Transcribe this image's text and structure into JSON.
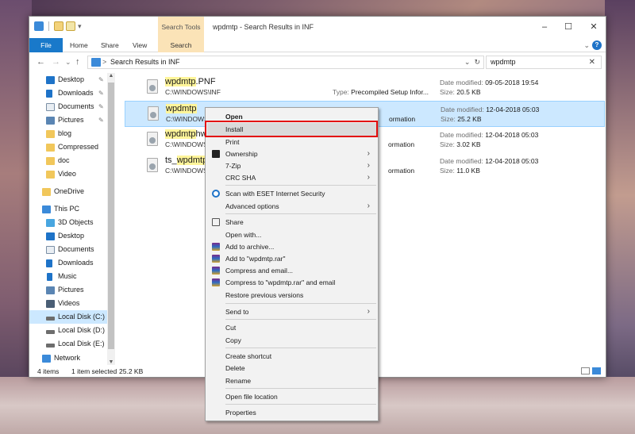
{
  "window": {
    "title": "wpdmtp - Search Results in INF",
    "minimize": "–",
    "maximize": "☐",
    "close": "✕"
  },
  "ribbon": {
    "context_header": "Search Tools",
    "tabs": [
      "File",
      "Home",
      "Share",
      "View",
      "Search"
    ],
    "collapse": "⌄",
    "help": "?"
  },
  "address": {
    "back": "←",
    "forward": "→",
    "recent": "⌄",
    "up": "↑",
    "chevron": ">",
    "path": "Search Results in INF",
    "dropdown": "⌄",
    "refresh": "↻",
    "search_value": "wpdmtp",
    "search_clear": "✕"
  },
  "nav": {
    "scroll_up": "▲",
    "scroll_down": "▼",
    "items": [
      {
        "label": "Desktop",
        "icon": "desktop-icon",
        "color": "#1e73c8",
        "pinned": true
      },
      {
        "label": "Downloads",
        "icon": "downloads-icon",
        "color": "#1e73c8",
        "pinned": true
      },
      {
        "label": "Documents",
        "icon": "documents-icon",
        "color": "#7b8fa5",
        "pinned": true
      },
      {
        "label": "Pictures",
        "icon": "pictures-icon",
        "color": "#5a85b3",
        "pinned": true
      },
      {
        "label": "blog",
        "icon": "folder-icon",
        "color": "#f1c75b",
        "pinned": false
      },
      {
        "label": "Compressed",
        "icon": "folder-icon",
        "color": "#f1c75b",
        "pinned": false
      },
      {
        "label": "doc",
        "icon": "folder-icon",
        "color": "#f1c75b",
        "pinned": false
      },
      {
        "label": "Video",
        "icon": "folder-icon",
        "color": "#f1c75b",
        "pinned": false
      },
      {
        "label": "OneDrive",
        "icon": "onedrive-icon",
        "color": "#f1c75b",
        "pinned": false
      },
      {
        "label": "This PC",
        "icon": "this-pc-icon",
        "color": "#3b8ad9",
        "pinned": false
      },
      {
        "label": "3D Objects",
        "icon": "3d-objects-icon",
        "color": "#48a6e0",
        "pinned": false
      },
      {
        "label": "Desktop",
        "icon": "desktop-icon",
        "color": "#1e73c8",
        "pinned": false
      },
      {
        "label": "Documents",
        "icon": "documents-icon",
        "color": "#7b8fa5",
        "pinned": false
      },
      {
        "label": "Downloads",
        "icon": "downloads-icon",
        "color": "#1e73c8",
        "pinned": false
      },
      {
        "label": "Music",
        "icon": "music-icon",
        "color": "#1e73c8",
        "pinned": false
      },
      {
        "label": "Pictures",
        "icon": "pictures-icon",
        "color": "#5a85b3",
        "pinned": false
      },
      {
        "label": "Videos",
        "icon": "videos-icon",
        "color": "#4a5e75",
        "pinned": false
      },
      {
        "label": "Local Disk (C:)",
        "icon": "drive-icon",
        "color": "#6d6d6d",
        "pinned": false
      },
      {
        "label": "Local Disk (D:)",
        "icon": "drive-icon",
        "color": "#6d6d6d",
        "pinned": false
      },
      {
        "label": "Local Disk (E:)",
        "icon": "drive-icon",
        "color": "#6d6d6d",
        "pinned": false
      },
      {
        "label": "Network",
        "icon": "network-icon",
        "color": "#3b8ad9",
        "pinned": false
      }
    ]
  },
  "files": [
    {
      "name_hl": "wpdmtp",
      "name_rest": ".PNF",
      "name_pre": "",
      "path": "C:\\WINDOWS\\INF",
      "type_label": "Type:",
      "type": "Precompiled Setup Infor...",
      "date_label": "Date modified:",
      "date": "09-05-2018 19:54",
      "size_label": "Size:",
      "size": "20.5 KB"
    },
    {
      "name_hl": "wpdmtp",
      "name_rest": "",
      "name_pre": "",
      "path": "C:\\WINDOWS",
      "type_label": "",
      "type": "ormation",
      "date_label": "Date modified:",
      "date": "12-04-2018 05:03",
      "size_label": "Size:",
      "size": "25.2 KB"
    },
    {
      "name_hl": "wpdmtp",
      "name_rest": "hw",
      "name_pre": "",
      "path": "C:\\WINDOWS",
      "type_label": "",
      "type": "ormation",
      "date_label": "Date modified:",
      "date": "12-04-2018 05:03",
      "size_label": "Size:",
      "size": "3.02 KB"
    },
    {
      "name_hl": "wpdmtp",
      "name_rest": "",
      "name_pre": "ts_",
      "path": "C:\\WINDOWS",
      "type_label": "",
      "type": "ormation",
      "date_label": "Date modified:",
      "date": "12-04-2018 05:03",
      "size_label": "Size:",
      "size": "11.0 KB"
    }
  ],
  "status": {
    "items": "4 items",
    "selected": "1 item selected",
    "size": "25.2 KB"
  },
  "context_menu": {
    "items": [
      {
        "label": "Open",
        "bold": true
      },
      {
        "label": "Install",
        "hover": true
      },
      {
        "label": "Print"
      },
      {
        "label": "Ownership",
        "icon": "ownership-icon",
        "arrow": "›"
      },
      {
        "label": "7-Zip",
        "arrow": "›"
      },
      {
        "label": "CRC SHA",
        "arrow": "›"
      },
      {
        "label": "Scan with ESET Internet Security",
        "icon": "eset-icon"
      },
      {
        "label": "Advanced options",
        "arrow": "›"
      },
      {
        "label": "Share",
        "icon": "share-icon"
      },
      {
        "label": "Open with..."
      },
      {
        "label": "Add to archive...",
        "icon": "winrar-icon"
      },
      {
        "label": "Add to \"wpdmtp.rar\"",
        "icon": "winrar-icon"
      },
      {
        "label": "Compress and email...",
        "icon": "winrar-icon"
      },
      {
        "label": "Compress to \"wpdmtp.rar\" and email",
        "icon": "winrar-icon"
      },
      {
        "label": "Restore previous versions"
      },
      {
        "label": "Send to",
        "arrow": "›"
      },
      {
        "label": "Cut"
      },
      {
        "label": "Copy"
      },
      {
        "label": "Create shortcut"
      },
      {
        "label": "Delete"
      },
      {
        "label": "Rename"
      },
      {
        "label": "Open file location"
      },
      {
        "label": "Properties"
      }
    ]
  }
}
